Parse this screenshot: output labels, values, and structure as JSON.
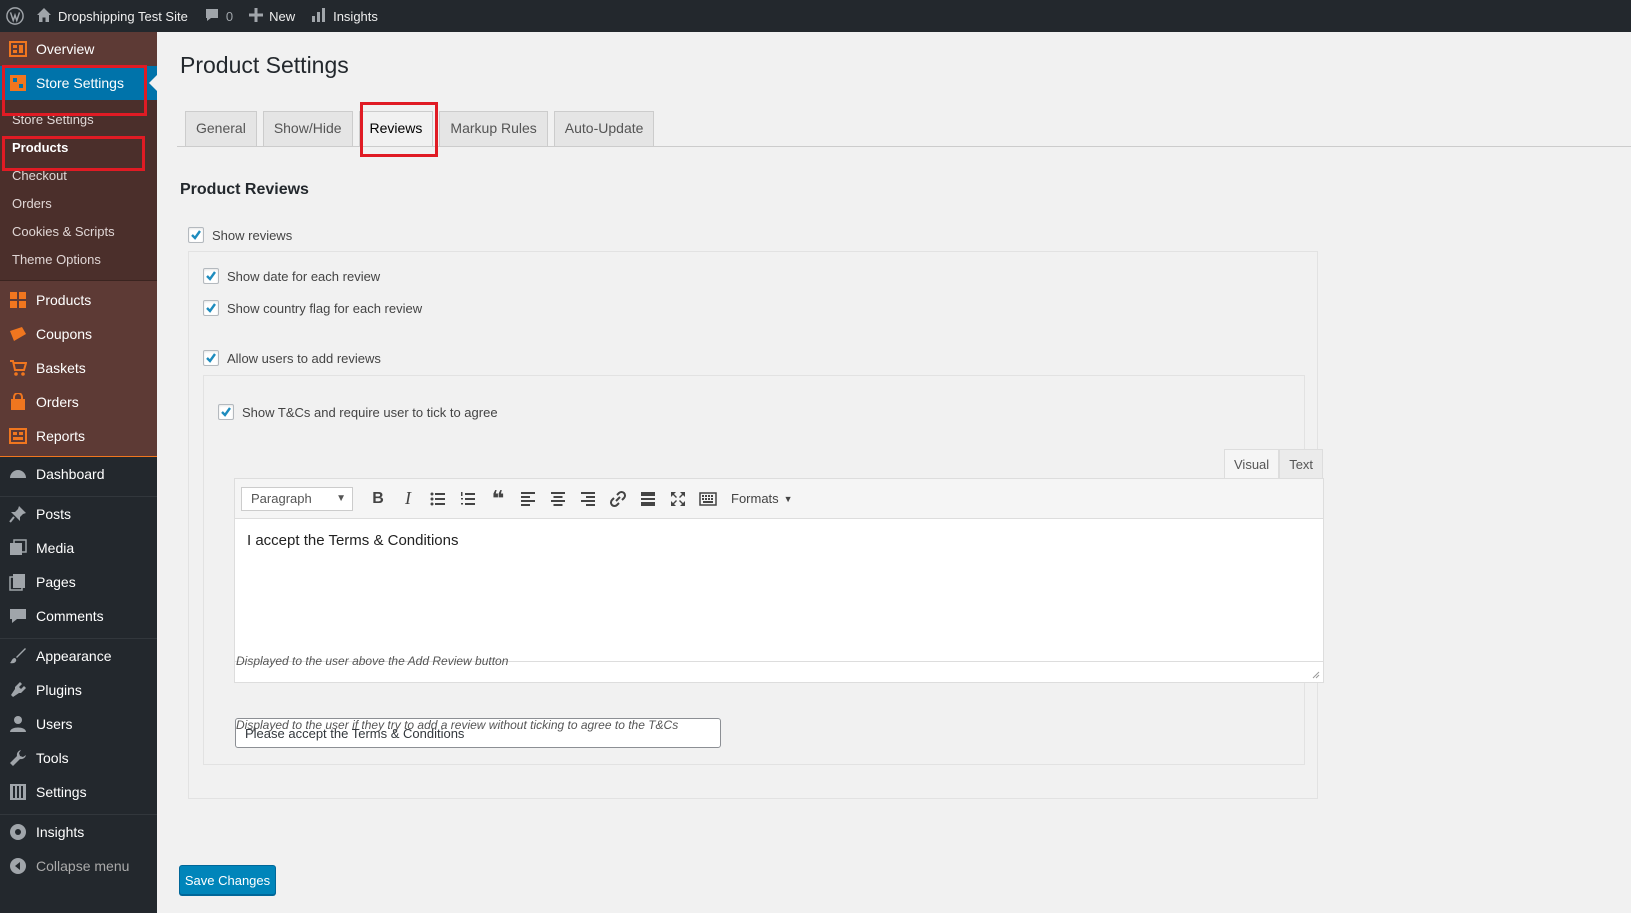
{
  "admin_bar": {
    "site_name": "Dropshipping Test Site",
    "comments_count": "0",
    "new_label": "New",
    "insights_label": "Insights"
  },
  "sidebar": {
    "overview": "Overview",
    "store_settings": "Store Settings",
    "submenu": [
      "Store Settings",
      "Products",
      "Checkout",
      "Orders",
      "Cookies & Scripts",
      "Theme Options"
    ],
    "store_items": [
      "Products",
      "Coupons",
      "Baskets",
      "Orders",
      "Reports"
    ],
    "wp_items": [
      "Dashboard",
      "Posts",
      "Media",
      "Pages",
      "Comments",
      "Appearance",
      "Plugins",
      "Users",
      "Tools",
      "Settings",
      "Insights"
    ],
    "collapse": "Collapse menu"
  },
  "page": {
    "title": "Product Settings",
    "tabs": [
      "General",
      "Show/Hide",
      "Reviews",
      "Markup Rules",
      "Auto-Update"
    ],
    "active_tab": "Reviews",
    "section_title": "Product Reviews"
  },
  "settings": {
    "show_reviews": "Show reviews",
    "show_date": "Show date for each review",
    "show_flag": "Show country flag for each review",
    "allow_add": "Allow users to add reviews",
    "show_tcs": "Show T&Cs and require user to tick to agree"
  },
  "editor": {
    "tab_visual": "Visual",
    "tab_text": "Text",
    "paragraph_select": "Paragraph",
    "formats": "Formats",
    "content": "I accept the Terms & Conditions",
    "description": "Displayed to the user above the Add Review button"
  },
  "error_field": {
    "value": "Please accept the Terms & Conditions",
    "description": "Displayed to the user if they try to add a review without ticking to agree to the T&Cs"
  },
  "save_label": "Save Changes",
  "colors": {
    "admin_dark": "#23282d",
    "store_brown": "#5d3a35",
    "wp_blue": "#0073aa",
    "button_blue": "#0085ba",
    "highlight_red": "#e01b24",
    "orange_icon": "#f0761f"
  }
}
